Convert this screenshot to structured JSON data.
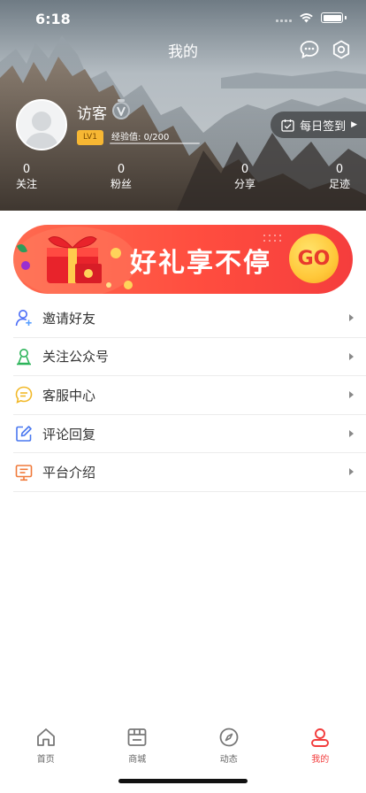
{
  "status_bar": {
    "time": "6:18"
  },
  "header": {
    "title": "我的",
    "chat_icon": "chat-bubble-icon",
    "settings_icon": "settings-icon"
  },
  "profile": {
    "username": "访客",
    "level": "LV1",
    "exp_label": "经验值",
    "exp_value": "0/200",
    "exp_progress": 0,
    "checkin_label": "每日签到"
  },
  "stats": [
    {
      "value": "0",
      "label": "关注"
    },
    {
      "value": "0",
      "label": "粉丝"
    },
    {
      "value": "0",
      "label": "分享"
    },
    {
      "value": "0",
      "label": "足迹"
    }
  ],
  "banner": {
    "text": "好礼享不停",
    "go": "GO"
  },
  "menu": [
    {
      "label": "邀请好友",
      "icon": "invite-user-icon",
      "color": "#4a6cf7"
    },
    {
      "label": "关注公众号",
      "icon": "follow-account-icon",
      "color": "#2db45a"
    },
    {
      "label": "客服中心",
      "icon": "customer-service-icon",
      "color": "#f2b92a"
    },
    {
      "label": "评论回复",
      "icon": "edit-comment-icon",
      "color": "#4a78f0"
    },
    {
      "label": "平台介绍",
      "icon": "platform-intro-icon",
      "color": "#f07a3a"
    }
  ],
  "tabs": [
    {
      "label": "首页",
      "icon": "home-icon",
      "active": false
    },
    {
      "label": "商城",
      "icon": "store-icon",
      "active": false
    },
    {
      "label": "动态",
      "icon": "compass-icon",
      "active": false
    },
    {
      "label": "我的",
      "icon": "profile-icon",
      "active": true
    }
  ],
  "colors": {
    "accent": "#f23c3c",
    "level_badge": "#f7b733"
  }
}
